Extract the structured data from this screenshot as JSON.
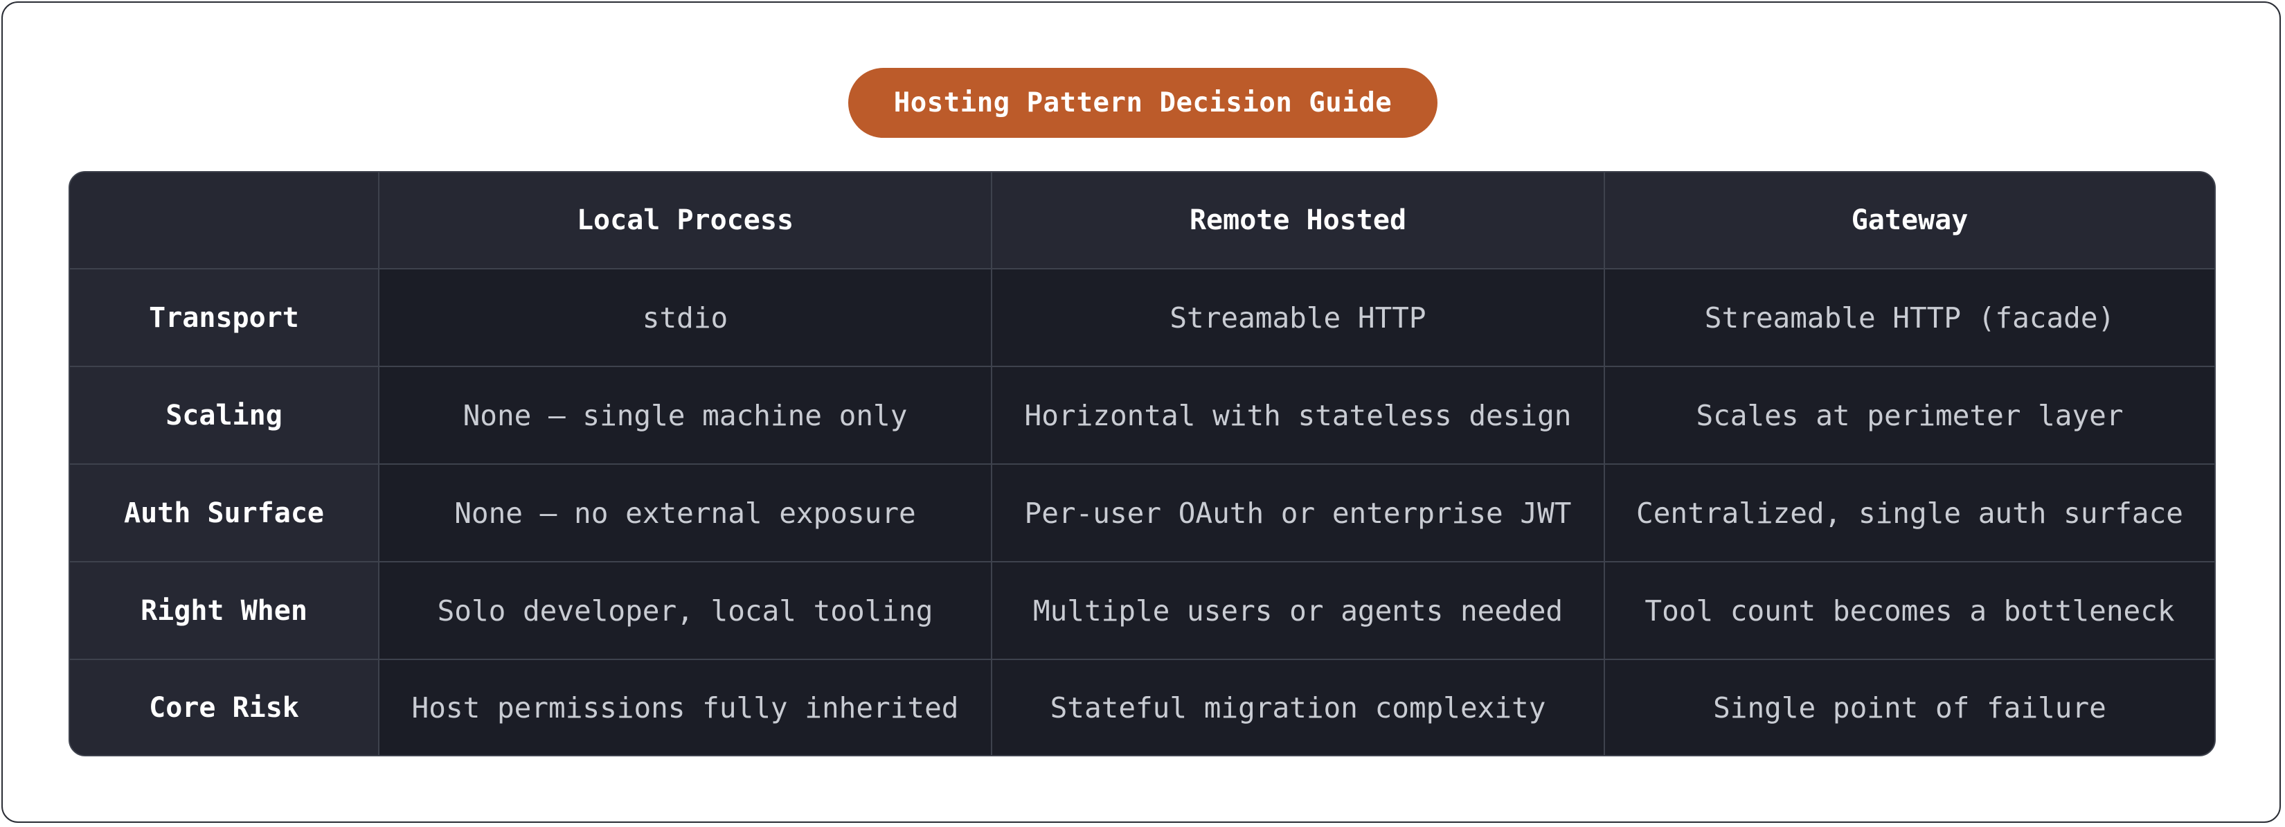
{
  "title": "Hosting Pattern Decision Guide",
  "table": {
    "columns": [
      "Local Process",
      "Remote Hosted",
      "Gateway"
    ],
    "rows": [
      {
        "label": "Transport",
        "cells": [
          "stdio",
          "Streamable HTTP",
          "Streamable HTTP (facade)"
        ]
      },
      {
        "label": "Scaling",
        "cells": [
          "None — single machine only",
          "Horizontal with stateless design",
          "Scales at perimeter layer"
        ]
      },
      {
        "label": "Auth Surface",
        "cells": [
          "None — no external exposure",
          "Per-user OAuth or enterprise JWT",
          "Centralized, single auth surface"
        ]
      },
      {
        "label": "Right When",
        "cells": [
          "Solo developer, local tooling",
          "Multiple users or agents needed",
          "Tool count becomes a bottleneck"
        ]
      },
      {
        "label": "Core Risk",
        "cells": [
          "Host permissions fully inherited",
          "Stateful migration complexity",
          "Single point of failure"
        ]
      }
    ]
  },
  "colors": {
    "accent": "#bc5b2a",
    "table_background": "#1b1d26",
    "header_background": "#262833",
    "grid_line": "#3e424d",
    "body_text": "#c9ccd3",
    "header_text": "#ffffff"
  }
}
